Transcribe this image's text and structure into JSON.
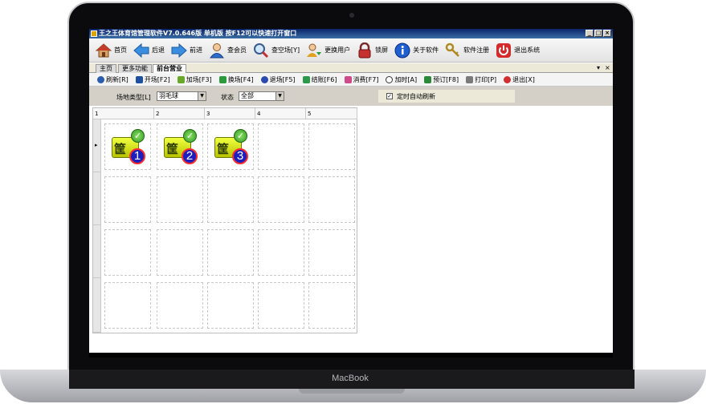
{
  "device": {
    "brand": "MacBook"
  },
  "window": {
    "title": "王之王体育馆管理软件V7.0.646版 单机版 按F12可以快速打开窗口",
    "controls": [
      "_",
      "□",
      "×"
    ]
  },
  "toolbar": [
    {
      "label": "首页",
      "icon": "home-icon"
    },
    {
      "label": "后退",
      "icon": "back-arrow-icon"
    },
    {
      "label": "前进",
      "icon": "forward-arrow-icon"
    },
    {
      "label": "查会员",
      "icon": "member-icon"
    },
    {
      "label": "查空场[Y]",
      "icon": "magnifier-icon"
    },
    {
      "label": "更换用户",
      "icon": "switch-user-icon"
    },
    {
      "label": "锁屏",
      "icon": "lock-icon"
    },
    {
      "label": "关于软件",
      "icon": "info-icon"
    },
    {
      "label": "软件注册",
      "icon": "keys-icon"
    },
    {
      "label": "退出系统",
      "icon": "power-icon"
    }
  ],
  "tabs": [
    {
      "label": "主页"
    },
    {
      "label": "更多功能"
    },
    {
      "label": "前台营业",
      "active": true
    }
  ],
  "tab_controls": [
    "▾",
    "×"
  ],
  "actions": [
    {
      "label": "刷新[R]",
      "color": "#2a5db0"
    },
    {
      "label": "开场[F2]",
      "color": "#1f4fa0"
    },
    {
      "label": "加场[F3]",
      "color": "#6aa82a"
    },
    {
      "label": "换场[F4]",
      "color": "#2a9a3a"
    },
    {
      "label": "退场[F5]",
      "color": "#2a4ab0"
    },
    {
      "label": "结账[F6]",
      "color": "#2a9a4a"
    },
    {
      "label": "消费[F7]",
      "color": "#d04a8a"
    },
    {
      "label": "加时[A]",
      "color": "#333333"
    },
    {
      "label": "预订[F8]",
      "color": "#2a8a3a"
    },
    {
      "label": "打印[P]",
      "color": "#7a7a7a"
    },
    {
      "label": "退出[X]",
      "color": "#d03030"
    }
  ],
  "filter": {
    "venue_type_label": "场地类型[L]",
    "venue_type_value": "羽毛球",
    "status_label": "状态",
    "status_value": "全部",
    "auto_refresh_label": "定时自动刷新",
    "auto_refresh_checked": "✓"
  },
  "grid": {
    "columns": [
      "1",
      "2",
      "3",
      "4",
      "5"
    ],
    "row_marker": "▸",
    "courts": [
      {
        "badge": "1",
        "board_text": "筐"
      },
      {
        "badge": "2",
        "board_text": "筐"
      },
      {
        "badge": "3",
        "board_text": "筐"
      }
    ],
    "check_mark": "✓"
  }
}
